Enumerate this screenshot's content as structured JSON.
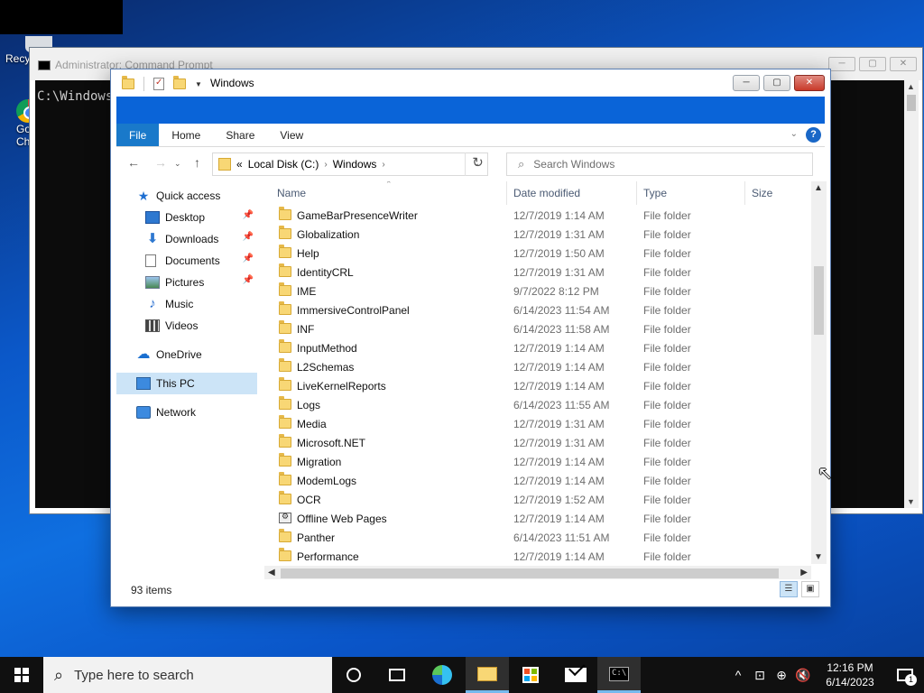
{
  "desktop": {
    "icons": [
      {
        "label": "Recy"
      },
      {
        "label": "Go"
      },
      {
        "label": "Ch"
      }
    ]
  },
  "cmd": {
    "title": "Administrator: Command Prompt",
    "body": "C:\\Windows\\",
    "buttons": {
      "min": "─",
      "max": "▢",
      "close": "✕"
    }
  },
  "explorer": {
    "title": "Windows",
    "window_buttons": {
      "min": "─",
      "max": "▢",
      "close": "✕"
    },
    "tabs": [
      {
        "label": "File"
      },
      {
        "label": "Home"
      },
      {
        "label": "Share"
      },
      {
        "label": "View"
      }
    ],
    "ribbon_color": "#0a64d8",
    "help_label": "?",
    "address": {
      "overflow": "«",
      "segments": [
        "Local Disk (C:)",
        "Windows"
      ]
    },
    "search_placeholder": "Search Windows",
    "nav": {
      "quick_access": "Quick access",
      "items": [
        {
          "label": "Desktop",
          "icon": "desktop-icon",
          "pinned": true
        },
        {
          "label": "Downloads",
          "icon": "download-arrow-icon",
          "pinned": true
        },
        {
          "label": "Documents",
          "icon": "document-icon",
          "pinned": true
        },
        {
          "label": "Pictures",
          "icon": "pictures-icon",
          "pinned": true
        },
        {
          "label": "Music",
          "icon": "music-note-icon",
          "pinned": false
        },
        {
          "label": "Videos",
          "icon": "video-icon",
          "pinned": false
        }
      ],
      "onedrive": "OneDrive",
      "this_pc": "This PC",
      "network": "Network"
    },
    "columns": {
      "name": "Name",
      "date": "Date modified",
      "type": "Type",
      "size": "Size"
    },
    "files": [
      {
        "name": "GameBarPresenceWriter",
        "date": "12/7/2019 1:14 AM",
        "type": "File folder"
      },
      {
        "name": "Globalization",
        "date": "12/7/2019 1:31 AM",
        "type": "File folder"
      },
      {
        "name": "Help",
        "date": "12/7/2019 1:50 AM",
        "type": "File folder"
      },
      {
        "name": "IdentityCRL",
        "date": "12/7/2019 1:31 AM",
        "type": "File folder"
      },
      {
        "name": "IME",
        "date": "9/7/2022 8:12 PM",
        "type": "File folder"
      },
      {
        "name": "ImmersiveControlPanel",
        "date": "6/14/2023 11:54 AM",
        "type": "File folder"
      },
      {
        "name": "INF",
        "date": "6/14/2023 11:58 AM",
        "type": "File folder"
      },
      {
        "name": "InputMethod",
        "date": "12/7/2019 1:14 AM",
        "type": "File folder"
      },
      {
        "name": "L2Schemas",
        "date": "12/7/2019 1:14 AM",
        "type": "File folder"
      },
      {
        "name": "LiveKernelReports",
        "date": "12/7/2019 1:14 AM",
        "type": "File folder"
      },
      {
        "name": "Logs",
        "date": "6/14/2023 11:55 AM",
        "type": "File folder"
      },
      {
        "name": "Media",
        "date": "12/7/2019 1:31 AM",
        "type": "File folder"
      },
      {
        "name": "Microsoft.NET",
        "date": "12/7/2019 1:31 AM",
        "type": "File folder"
      },
      {
        "name": "Migration",
        "date": "12/7/2019 1:14 AM",
        "type": "File folder"
      },
      {
        "name": "ModemLogs",
        "date": "12/7/2019 1:14 AM",
        "type": "File folder"
      },
      {
        "name": "OCR",
        "date": "12/7/2019 1:52 AM",
        "type": "File folder"
      },
      {
        "name": "Offline Web Pages",
        "date": "12/7/2019 1:14 AM",
        "type": "File folder",
        "special_icon": true
      },
      {
        "name": "Panther",
        "date": "6/14/2023 11:51 AM",
        "type": "File folder"
      },
      {
        "name": "Performance",
        "date": "12/7/2019 1:14 AM",
        "type": "File folder"
      }
    ],
    "status_count": "93 items"
  },
  "taskbar": {
    "search_placeholder": "Type here to search",
    "time": "12:16 PM",
    "date": "6/14/2023",
    "notification_count": "1"
  }
}
